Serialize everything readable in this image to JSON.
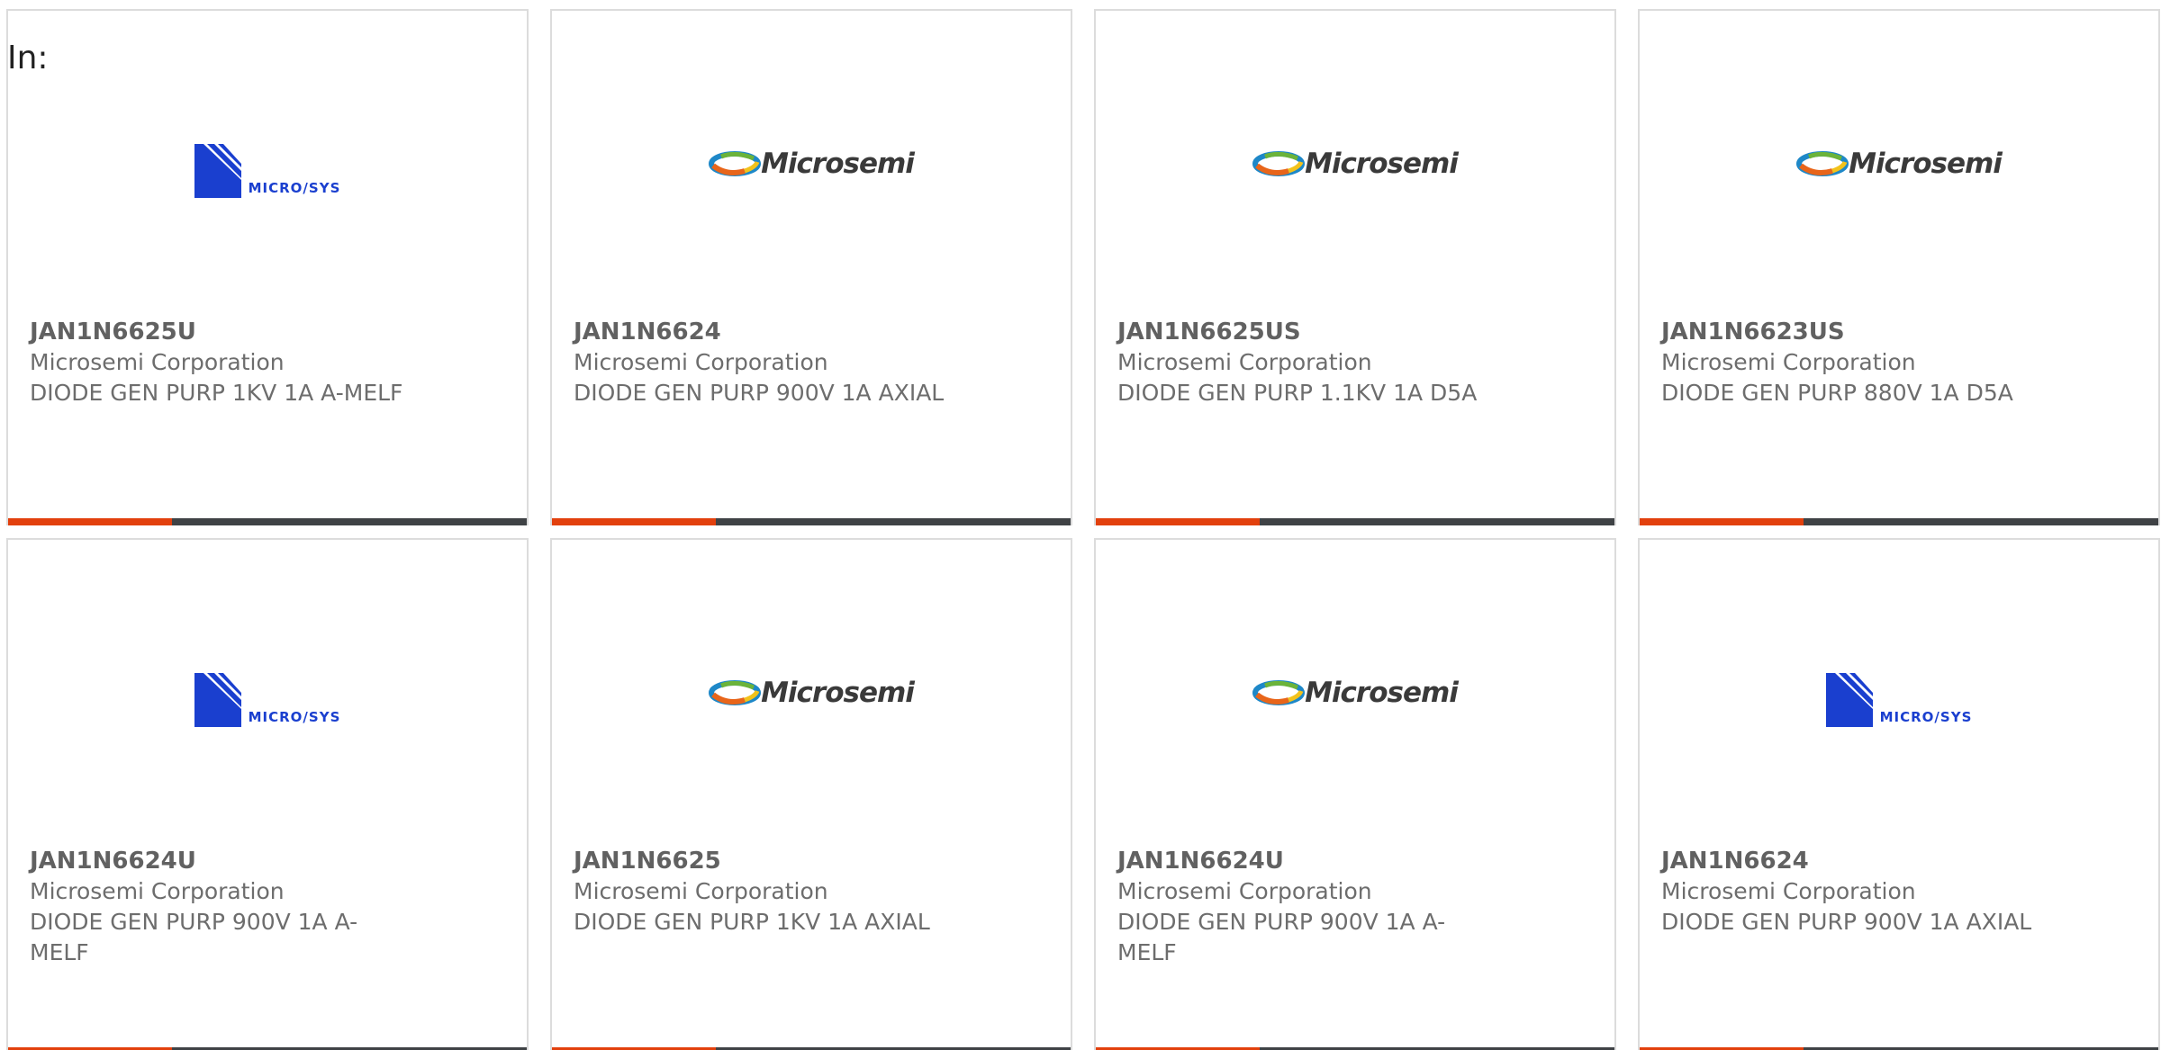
{
  "header": {
    "in_label": "In:"
  },
  "colors": {
    "accent": "#e2400d",
    "bar": "#3f4245",
    "microsys_blue": "#1a3fcf"
  },
  "logos": {
    "microsemi": {
      "icon": "microsemi-swirl-icon",
      "text": "Microsemi"
    },
    "microsys": {
      "icon": "microsys-logo-icon",
      "text": "MICRO/SYS"
    }
  },
  "products": [
    {
      "logo": "microsys",
      "part": "JAN1N6625U",
      "manufacturer": "Microsemi Corporation",
      "description": "DIODE GEN PURP 1KV 1A A-MELF"
    },
    {
      "logo": "microsemi",
      "part": "JAN1N6624",
      "manufacturer": "Microsemi Corporation",
      "description": "DIODE GEN PURP 900V 1A AXIAL"
    },
    {
      "logo": "microsemi",
      "part": "JAN1N6625US",
      "manufacturer": "Microsemi Corporation",
      "description": "DIODE GEN PURP 1.1KV 1A D5A"
    },
    {
      "logo": "microsemi",
      "part": "JAN1N6623US",
      "manufacturer": "Microsemi Corporation",
      "description": "DIODE GEN PURP 880V 1A D5A"
    },
    {
      "logo": "microsys",
      "part": "JAN1N6624U",
      "manufacturer": "Microsemi Corporation",
      "description": "DIODE GEN PURP 900V 1A A-MELF"
    },
    {
      "logo": "microsemi",
      "part": "JAN1N6625",
      "manufacturer": "Microsemi Corporation",
      "description": "DIODE GEN PURP 1KV 1A AXIAL"
    },
    {
      "logo": "microsemi",
      "part": "JAN1N6624U",
      "manufacturer": "Microsemi Corporation",
      "description": "DIODE GEN PURP 900V 1A A-MELF"
    },
    {
      "logo": "microsys",
      "part": "JAN1N6624",
      "manufacturer": "Microsemi Corporation",
      "description": "DIODE GEN PURP 900V 1A AXIAL"
    }
  ]
}
